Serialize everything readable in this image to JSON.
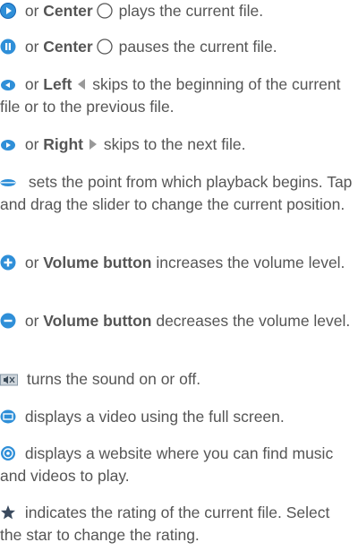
{
  "entries": [
    {
      "icon": "play-icon",
      "text1": " or ",
      "bold": "Center",
      "text2": " plays the current file."
    },
    {
      "icon": "pause-icon",
      "text1": " or ",
      "bold": "Center",
      "text2": " pauses the current file."
    },
    {
      "icon": "previous-icon",
      "text1": " or ",
      "bold": "Left",
      "text2": " skips to the beginning of the current file or to the previous file."
    },
    {
      "icon": "next-icon",
      "text1": " or ",
      "bold": "Right",
      "text2": " skips to the next file."
    },
    {
      "icon": "slider-icon",
      "text": " sets the point from which playback begins. Tap and drag the slider to change the current position."
    },
    {
      "icon": "volume-up-icon",
      "text1": " or ",
      "bold": "Volume button",
      "text2": " increases the volume level."
    },
    {
      "icon": "volume-down-icon",
      "text1": " or ",
      "bold": "Volume button",
      "text2": " decreases the volume level."
    },
    {
      "icon": "mute-icon",
      "text": " turns the sound on or off."
    },
    {
      "icon": "fullscreen-icon",
      "text": " displays a video using the full screen."
    },
    {
      "icon": "web-icon",
      "text": " displays a website where you can find music and videos to play."
    },
    {
      "icon": "star-icon",
      "text": " indicates the rating of the current file. Select the star to change the rating."
    }
  ],
  "colors": {
    "text": "#555555",
    "icon_blue": "#2f8fd8",
    "icon_blue_dark": "#1565b5"
  }
}
